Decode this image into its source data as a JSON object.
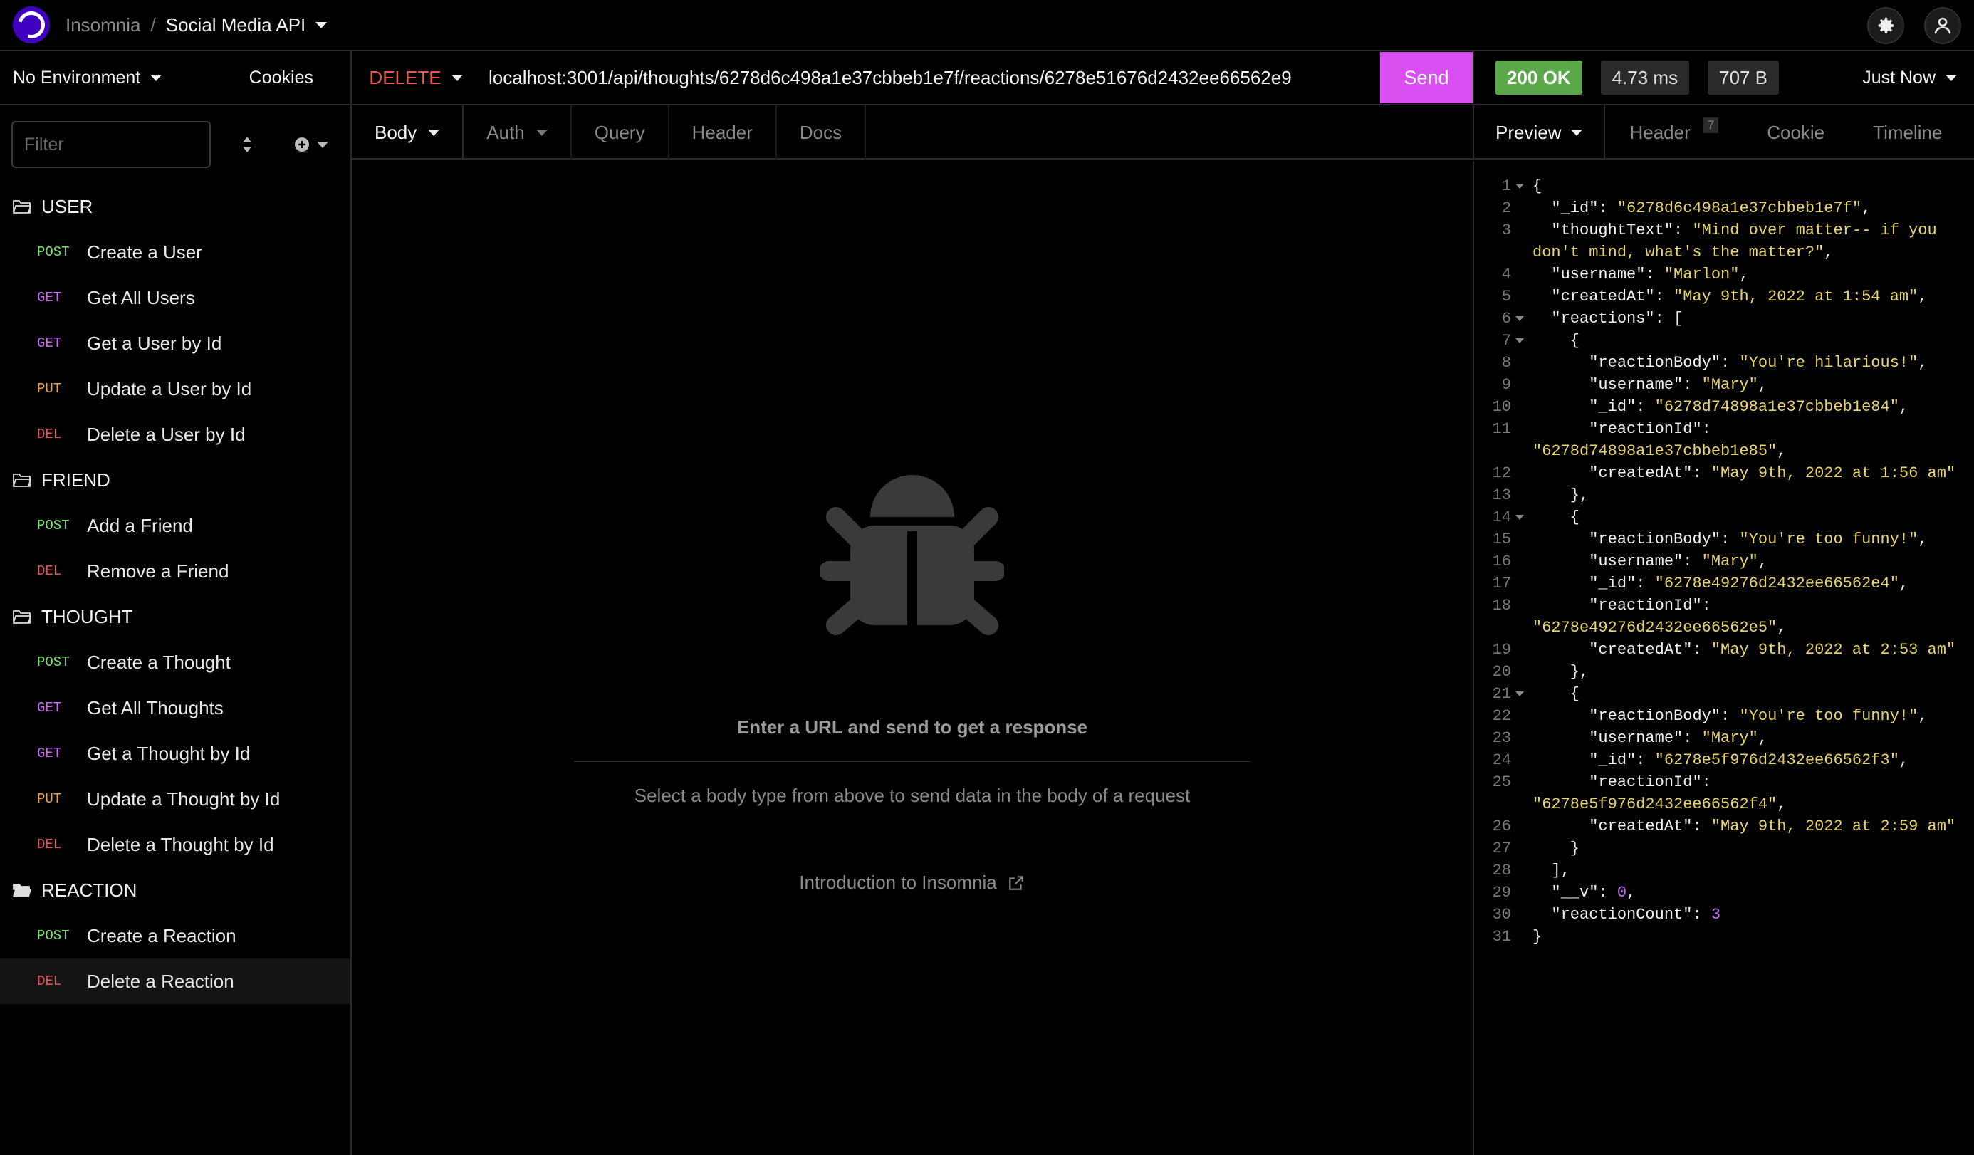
{
  "topbar": {
    "org": "Insomnia",
    "separator": "/",
    "project": "Social Media API"
  },
  "sidebar": {
    "environment": "No Environment",
    "cookies": "Cookies",
    "filter_placeholder": "Filter",
    "tree": [
      {
        "type": "folder",
        "label": "USER"
      },
      {
        "type": "request",
        "method": "POST",
        "label": "Create a User"
      },
      {
        "type": "request",
        "method": "GET",
        "label": "Get All Users"
      },
      {
        "type": "request",
        "method": "GET",
        "label": "Get a User by Id"
      },
      {
        "type": "request",
        "method": "PUT",
        "label": "Update a User by Id"
      },
      {
        "type": "request",
        "method": "DEL",
        "label": "Delete a User by Id"
      },
      {
        "type": "folder",
        "label": "FRIEND"
      },
      {
        "type": "request",
        "method": "POST",
        "label": "Add a Friend"
      },
      {
        "type": "request",
        "method": "DEL",
        "label": "Remove a Friend"
      },
      {
        "type": "folder",
        "label": "THOUGHT"
      },
      {
        "type": "request",
        "method": "POST",
        "label": "Create a Thought"
      },
      {
        "type": "request",
        "method": "GET",
        "label": "Get All Thoughts"
      },
      {
        "type": "request",
        "method": "GET",
        "label": "Get a Thought by Id"
      },
      {
        "type": "request",
        "method": "PUT",
        "label": "Update a Thought by Id"
      },
      {
        "type": "request",
        "method": "DEL",
        "label": "Delete a Thought by Id"
      },
      {
        "type": "folder",
        "label": "REACTION",
        "open": true
      },
      {
        "type": "request",
        "method": "POST",
        "label": "Create a Reaction"
      },
      {
        "type": "request",
        "method": "DEL",
        "label": "Delete a Reaction",
        "active": true
      }
    ]
  },
  "request": {
    "method": "DELETE",
    "url": "localhost:3001/api/thoughts/6278d6c498a1e37cbbeb1e7f/reactions/6278e51676d2432ee66562e9",
    "send_label": "Send",
    "tabs": [
      "Body",
      "Auth",
      "Query",
      "Header",
      "Docs"
    ]
  },
  "empty_state": {
    "title": "Enter a URL and send to get a response",
    "subtitle": "Select a body type from above to send data in the body of a request",
    "link": "Introduction to Insomnia"
  },
  "response": {
    "status": "200 OK",
    "time": "4.73 ms",
    "size": "707 B",
    "when": "Just Now",
    "tabs": {
      "preview": "Preview",
      "header": "Header",
      "header_count": "7",
      "cookie": "Cookie",
      "timeline": "Timeline"
    },
    "colors": {
      "ok": "#5aa84a",
      "send": "#d94ff2",
      "delete": "#e8574f"
    },
    "lines": [
      {
        "n": "1",
        "fold": true,
        "parts": [
          [
            "p",
            "{"
          ]
        ]
      },
      {
        "n": "2",
        "parts": [
          [
            "p",
            "  "
          ],
          [
            "k",
            "\"_id\""
          ],
          [
            "p",
            ": "
          ],
          [
            "s",
            "\"6278d6c498a1e37cbbeb1e7f\""
          ],
          [
            "p",
            ","
          ]
        ]
      },
      {
        "n": "3",
        "parts": [
          [
            "p",
            "  "
          ],
          [
            "k",
            "\"thoughtText\""
          ],
          [
            "p",
            ": "
          ],
          [
            "s",
            "\"Mind over matter-- if you"
          ]
        ]
      },
      {
        "n": "",
        "parts": [
          [
            "s",
            "don't mind, what's the matter?\""
          ],
          [
            "p",
            ","
          ]
        ]
      },
      {
        "n": "4",
        "parts": [
          [
            "p",
            "  "
          ],
          [
            "k",
            "\"username\""
          ],
          [
            "p",
            ": "
          ],
          [
            "s",
            "\"Marlon\""
          ],
          [
            "p",
            ","
          ]
        ]
      },
      {
        "n": "5",
        "parts": [
          [
            "p",
            "  "
          ],
          [
            "k",
            "\"createdAt\""
          ],
          [
            "p",
            ": "
          ],
          [
            "s",
            "\"May 9th, 2022 at 1:54 am\""
          ],
          [
            "p",
            ","
          ]
        ]
      },
      {
        "n": "6",
        "fold": true,
        "parts": [
          [
            "p",
            "  "
          ],
          [
            "k",
            "\"reactions\""
          ],
          [
            "p",
            ": ["
          ]
        ]
      },
      {
        "n": "7",
        "fold": true,
        "parts": [
          [
            "p",
            "    {"
          ]
        ]
      },
      {
        "n": "8",
        "parts": [
          [
            "p",
            "      "
          ],
          [
            "k",
            "\"reactionBody\""
          ],
          [
            "p",
            ": "
          ],
          [
            "s",
            "\"You're hilarious!\""
          ],
          [
            "p",
            ","
          ]
        ]
      },
      {
        "n": "9",
        "parts": [
          [
            "p",
            "      "
          ],
          [
            "k",
            "\"username\""
          ],
          [
            "p",
            ": "
          ],
          [
            "s",
            "\"Mary\""
          ],
          [
            "p",
            ","
          ]
        ]
      },
      {
        "n": "10",
        "parts": [
          [
            "p",
            "      "
          ],
          [
            "k",
            "\"_id\""
          ],
          [
            "p",
            ": "
          ],
          [
            "s",
            "\"6278d74898a1e37cbbeb1e84\""
          ],
          [
            "p",
            ","
          ]
        ]
      },
      {
        "n": "11",
        "parts": [
          [
            "p",
            "      "
          ],
          [
            "k",
            "\"reactionId\""
          ],
          [
            "p",
            ":"
          ]
        ]
      },
      {
        "n": "",
        "parts": [
          [
            "s",
            "\"6278d74898a1e37cbbeb1e85\""
          ],
          [
            "p",
            ","
          ]
        ]
      },
      {
        "n": "12",
        "parts": [
          [
            "p",
            "      "
          ],
          [
            "k",
            "\"createdAt\""
          ],
          [
            "p",
            ": "
          ],
          [
            "s",
            "\"May 9th, 2022 at 1:56 am\""
          ]
        ]
      },
      {
        "n": "13",
        "parts": [
          [
            "p",
            "    },"
          ]
        ]
      },
      {
        "n": "14",
        "fold": true,
        "parts": [
          [
            "p",
            "    {"
          ]
        ]
      },
      {
        "n": "15",
        "parts": [
          [
            "p",
            "      "
          ],
          [
            "k",
            "\"reactionBody\""
          ],
          [
            "p",
            ": "
          ],
          [
            "s",
            "\"You're too funny!\""
          ],
          [
            "p",
            ","
          ]
        ]
      },
      {
        "n": "16",
        "parts": [
          [
            "p",
            "      "
          ],
          [
            "k",
            "\"username\""
          ],
          [
            "p",
            ": "
          ],
          [
            "s",
            "\"Mary\""
          ],
          [
            "p",
            ","
          ]
        ]
      },
      {
        "n": "17",
        "parts": [
          [
            "p",
            "      "
          ],
          [
            "k",
            "\"_id\""
          ],
          [
            "p",
            ": "
          ],
          [
            "s",
            "\"6278e49276d2432ee66562e4\""
          ],
          [
            "p",
            ","
          ]
        ]
      },
      {
        "n": "18",
        "parts": [
          [
            "p",
            "      "
          ],
          [
            "k",
            "\"reactionId\""
          ],
          [
            "p",
            ":"
          ]
        ]
      },
      {
        "n": "",
        "parts": [
          [
            "s",
            "\"6278e49276d2432ee66562e5\""
          ],
          [
            "p",
            ","
          ]
        ]
      },
      {
        "n": "19",
        "parts": [
          [
            "p",
            "      "
          ],
          [
            "k",
            "\"createdAt\""
          ],
          [
            "p",
            ": "
          ],
          [
            "s",
            "\"May 9th, 2022 at 2:53 am\""
          ]
        ]
      },
      {
        "n": "20",
        "parts": [
          [
            "p",
            "    },"
          ]
        ]
      },
      {
        "n": "21",
        "fold": true,
        "parts": [
          [
            "p",
            "    {"
          ]
        ]
      },
      {
        "n": "22",
        "parts": [
          [
            "p",
            "      "
          ],
          [
            "k",
            "\"reactionBody\""
          ],
          [
            "p",
            ": "
          ],
          [
            "s",
            "\"You're too funny!\""
          ],
          [
            "p",
            ","
          ]
        ]
      },
      {
        "n": "23",
        "parts": [
          [
            "p",
            "      "
          ],
          [
            "k",
            "\"username\""
          ],
          [
            "p",
            ": "
          ],
          [
            "s",
            "\"Mary\""
          ],
          [
            "p",
            ","
          ]
        ]
      },
      {
        "n": "24",
        "parts": [
          [
            "p",
            "      "
          ],
          [
            "k",
            "\"_id\""
          ],
          [
            "p",
            ": "
          ],
          [
            "s",
            "\"6278e5f976d2432ee66562f3\""
          ],
          [
            "p",
            ","
          ]
        ]
      },
      {
        "n": "25",
        "parts": [
          [
            "p",
            "      "
          ],
          [
            "k",
            "\"reactionId\""
          ],
          [
            "p",
            ":"
          ]
        ]
      },
      {
        "n": "",
        "parts": [
          [
            "s",
            "\"6278e5f976d2432ee66562f4\""
          ],
          [
            "p",
            ","
          ]
        ]
      },
      {
        "n": "26",
        "parts": [
          [
            "p",
            "      "
          ],
          [
            "k",
            "\"createdAt\""
          ],
          [
            "p",
            ": "
          ],
          [
            "s",
            "\"May 9th, 2022 at 2:59 am\""
          ]
        ]
      },
      {
        "n": "27",
        "parts": [
          [
            "p",
            "    }"
          ]
        ]
      },
      {
        "n": "28",
        "parts": [
          [
            "p",
            "  ],"
          ]
        ]
      },
      {
        "n": "29",
        "parts": [
          [
            "p",
            "  "
          ],
          [
            "k",
            "\"__v\""
          ],
          [
            "p",
            ": "
          ],
          [
            "n",
            "0"
          ],
          [
            "p",
            ","
          ]
        ]
      },
      {
        "n": "30",
        "parts": [
          [
            "p",
            "  "
          ],
          [
            "k",
            "\"reactionCount\""
          ],
          [
            "p",
            ": "
          ],
          [
            "n",
            "3"
          ]
        ]
      },
      {
        "n": "31",
        "parts": [
          [
            "p",
            "}"
          ]
        ]
      }
    ]
  }
}
